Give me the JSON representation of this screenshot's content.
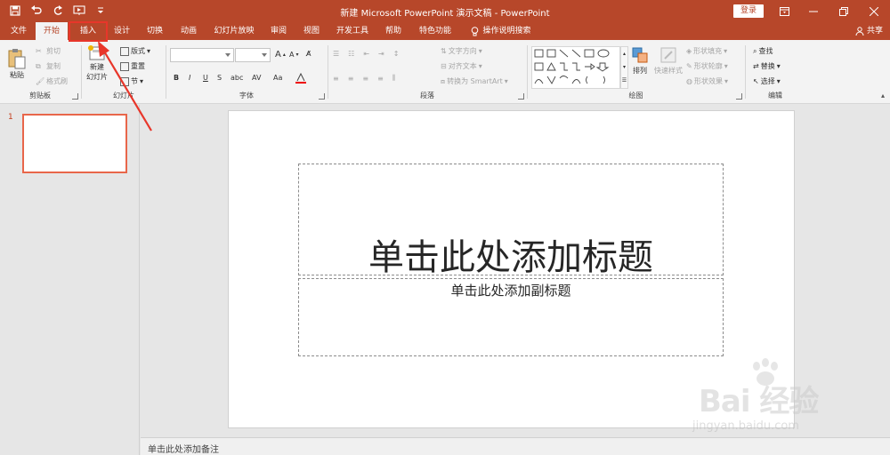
{
  "window": {
    "title": "新建 Microsoft PowerPoint 演示文稿 - PowerPoint",
    "login_label": "登录",
    "share_label": "共享"
  },
  "qat": {
    "save_icon": "save-icon",
    "undo_icon": "undo-icon",
    "redo_icon": "redo-icon",
    "start_icon": "present-from-start-icon"
  },
  "tabs": {
    "file": "文件",
    "home": "开始",
    "insert": "插入",
    "design": "设计",
    "transitions": "切换",
    "animations": "动画",
    "slideshow": "幻灯片放映",
    "review": "审阅",
    "view": "视图",
    "developer": "开发工具",
    "help": "帮助",
    "features": "特色功能",
    "tellme": "操作说明搜索"
  },
  "ribbon": {
    "clipboard": {
      "label": "剪贴板",
      "paste": "粘贴",
      "cut": "剪切",
      "copy": "复制",
      "format_painter": "格式刷"
    },
    "slides": {
      "label": "幻灯片",
      "new_slide_line1": "新建",
      "new_slide_line2": "幻灯片",
      "layout": "版式",
      "reset": "重置",
      "section": "节"
    },
    "font": {
      "label": "字体",
      "bold": "B",
      "italic": "I",
      "underline": "U",
      "strike": "S",
      "shadow": "abc",
      "spacing": "AV",
      "case": "Aa",
      "grow": "A",
      "shrink": "A"
    },
    "paragraph": {
      "label": "段落",
      "text_direction": "文字方向",
      "align_text": "对齐文本",
      "convert_smartart": "转换为 SmartArt"
    },
    "drawing": {
      "label": "绘图",
      "arrange": "排列",
      "quick_styles": "快速样式",
      "shape_fill": "形状填充",
      "shape_outline": "形状轮廓",
      "shape_effects": "形状效果"
    },
    "editing": {
      "label": "编辑",
      "find": "查找",
      "replace": "替换",
      "select": "选择"
    }
  },
  "thumbnails": {
    "slide_number": "1"
  },
  "slide": {
    "title_placeholder": "单击此处添加标题",
    "subtitle_placeholder": "单击此处添加副标题"
  },
  "notes": {
    "placeholder": "单击此处添加备注"
  },
  "watermark": {
    "logo": "Bai 经验",
    "url": "jingyan.baidu.com"
  },
  "colors": {
    "accent": "#b7472a",
    "highlight": "#e8362a"
  }
}
